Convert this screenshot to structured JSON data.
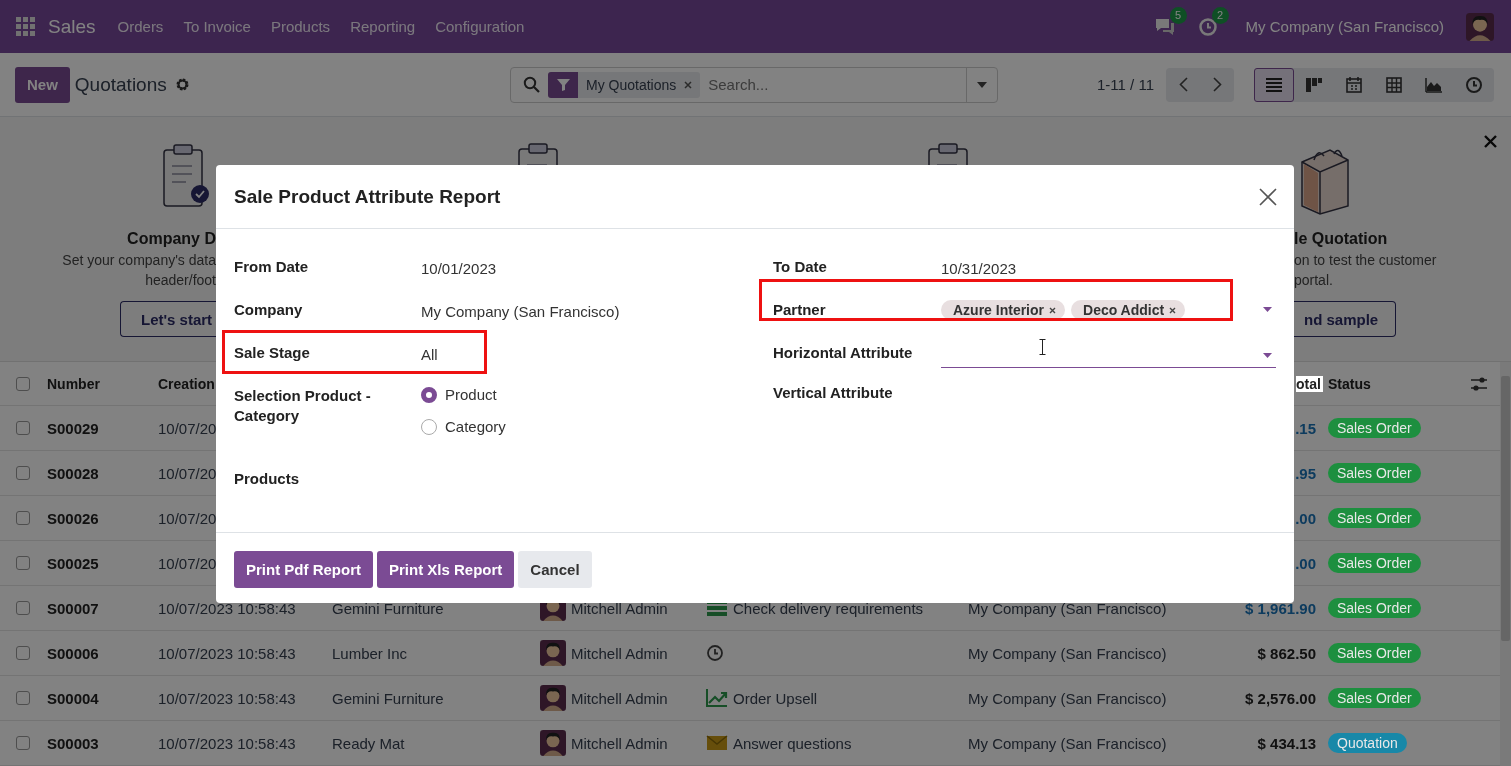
{
  "navbar": {
    "app": "Sales",
    "menu": [
      "Orders",
      "To Invoice",
      "Products",
      "Reporting",
      "Configuration"
    ],
    "messages_count": "5",
    "activities_count": "2",
    "company": "My Company (San Francisco)"
  },
  "control_panel": {
    "new_button": "New",
    "title": "Quotations",
    "search": {
      "facet": "My Quotations",
      "placeholder": "Search..."
    },
    "pager": "1-11 / 11",
    "views": [
      {
        "kind": "list",
        "selected": true
      },
      {
        "kind": "kanban",
        "selected": false
      },
      {
        "kind": "calendar",
        "selected": false
      },
      {
        "kind": "pivot",
        "selected": false
      },
      {
        "kind": "graph",
        "selected": false
      },
      {
        "kind": "activity",
        "selected": false
      }
    ]
  },
  "banner": {
    "cards": [
      {
        "kind": "company",
        "title": "Company D",
        "lines": [
          "Set your company's data",
          "header/foot"
        ],
        "button": "Let's start"
      },
      {
        "kind": "sample",
        "title": "le Quotation",
        "lines": [
          "on to test the customer",
          "portal."
        ],
        "button": "nd sample"
      }
    ]
  },
  "table": {
    "select_all_checked": false,
    "columns": [
      {
        "kind": "number",
        "label": "Number"
      },
      {
        "kind": "date",
        "label": "Creation"
      },
      {
        "kind": "total",
        "label": "otal"
      },
      {
        "kind": "status",
        "label": "Status"
      }
    ],
    "rows": [
      {
        "checked": false,
        "number": "S00029",
        "date": "10/07/20",
        "total": ".15",
        "linked": true,
        "status": {
          "label": "Sales Order",
          "color": "#1d8f3f"
        }
      },
      {
        "checked": false,
        "number": "S00028",
        "date": "10/07/20",
        "total": ".95",
        "linked": true,
        "status": {
          "label": "Sales Order",
          "color": "#1d8f3f"
        }
      },
      {
        "checked": false,
        "number": "S00026",
        "date": "10/07/20",
        "total": ".00",
        "linked": true,
        "status": {
          "label": "Sales Order",
          "color": "#1d8f3f"
        }
      },
      {
        "checked": false,
        "number": "S00025",
        "date": "10/07/20",
        "total": ".00",
        "linked": true,
        "status": {
          "label": "Sales Order",
          "color": "#1d8f3f"
        }
      },
      {
        "checked": false,
        "number": "S00007",
        "date": "10/07/2023 10:58:43",
        "customer": "Gemini Furniture",
        "salesperson": "Mitchell Admin",
        "activity": {
          "kind": "todo",
          "text": "Check delivery requirements"
        },
        "company": "My Company (San Francisco)",
        "total": "$ 1,961.90",
        "linked": true,
        "status": {
          "label": "Sales Order",
          "color": "#1d8f3f"
        }
      },
      {
        "checked": false,
        "number": "S00006",
        "date": "10/07/2023 10:58:43",
        "customer": "Lumber Inc",
        "salesperson": "Mitchell Admin",
        "activity": {
          "kind": "clock"
        },
        "company": "My Company (San Francisco)",
        "total": "$ 862.50",
        "linked": false,
        "status": {
          "label": "Sales Order",
          "color": "#1d8f3f"
        }
      },
      {
        "checked": false,
        "number": "S00004",
        "date": "10/07/2023 10:58:43",
        "customer": "Gemini Furniture",
        "salesperson": "Mitchell Admin",
        "activity": {
          "kind": "upsell",
          "text": "Order Upsell"
        },
        "company": "My Company (San Francisco)",
        "total": "$ 2,576.00",
        "linked": false,
        "status": {
          "label": "Sales Order",
          "color": "#1d8f3f"
        }
      },
      {
        "checked": false,
        "number": "S00003",
        "date": "10/07/2023 10:58:43",
        "customer": "Ready Mat",
        "salesperson": "Mitchell Admin",
        "activity": {
          "kind": "email",
          "text": "Answer questions"
        },
        "company": "My Company (San Francisco)",
        "total": "$ 434.13",
        "linked": false,
        "status": {
          "label": "Quotation",
          "color": "#1888a8"
        }
      }
    ]
  },
  "dialog": {
    "title": "Sale Product Attribute Report",
    "left_fields": [
      {
        "kind": "text",
        "label": "From Date",
        "value": "10/01/2023",
        "highlighted": false
      },
      {
        "kind": "text",
        "label": "Company",
        "value": "My Company (San Francisco)",
        "highlighted": false
      },
      {
        "kind": "text",
        "label": "Sale Stage",
        "value": "All",
        "highlighted": true
      },
      {
        "kind": "radio",
        "label": "Selection Product - Category",
        "highlighted": false,
        "options": [
          {
            "label": "Product",
            "selected": true
          },
          {
            "label": "Category",
            "selected": false
          }
        ]
      },
      {
        "kind": "empty",
        "label": "Products",
        "highlighted": false
      }
    ],
    "right_fields": [
      {
        "kind": "text",
        "label": "To Date",
        "value": "10/31/2023",
        "highlighted": false
      },
      {
        "kind": "tags",
        "label": "Partner",
        "highlighted": true,
        "tags": [
          "Azure Interior",
          "Deco Addict"
        ]
      },
      {
        "kind": "select",
        "label": "Horizontal Attribute",
        "highlighted": false,
        "focused": true
      },
      {
        "kind": "empty",
        "label": "Vertical Attribute",
        "highlighted": false
      }
    ],
    "buttons": [
      {
        "kind": "primary",
        "label": "Print Pdf Report"
      },
      {
        "kind": "primary",
        "label": "Print Xls Report"
      },
      {
        "kind": "secondary",
        "label": "Cancel"
      }
    ]
  }
}
